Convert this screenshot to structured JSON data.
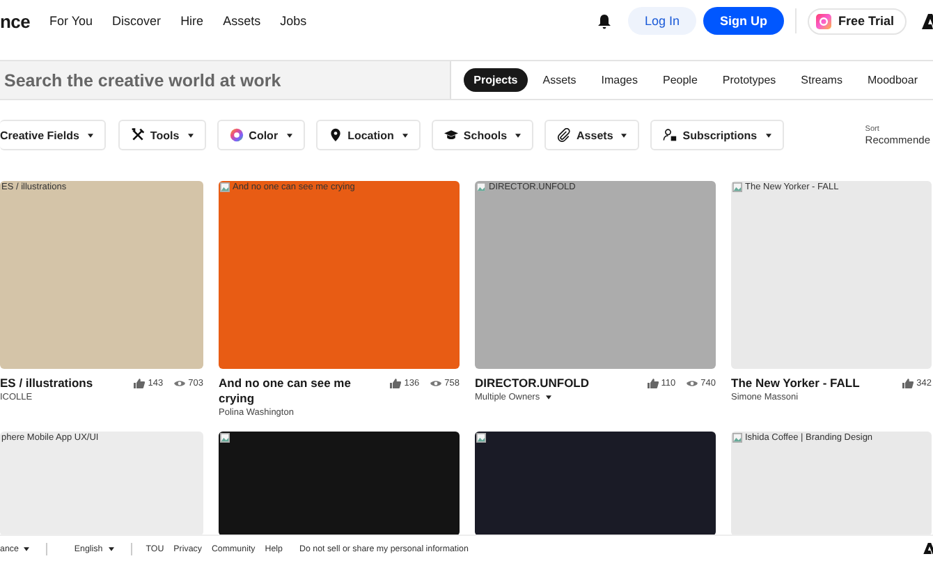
{
  "header": {
    "logo": "nce",
    "nav": [
      "For You",
      "Discover",
      "Hire",
      "Assets",
      "Jobs"
    ],
    "login": "Log In",
    "signup": "Sign Up",
    "trial": "Free Trial"
  },
  "search": {
    "placeholder": "Search the creative world at work"
  },
  "tabs": [
    {
      "label": "Projects",
      "selected": true
    },
    {
      "label": "Assets",
      "selected": false
    },
    {
      "label": "Images",
      "selected": false
    },
    {
      "label": "People",
      "selected": false
    },
    {
      "label": "Prototypes",
      "selected": false
    },
    {
      "label": "Streams",
      "selected": false
    },
    {
      "label": "Moodboar",
      "selected": false
    }
  ],
  "filters": [
    {
      "label": "Creative Fields",
      "kind": "none"
    },
    {
      "label": "Tools",
      "kind": "tools"
    },
    {
      "label": "Color",
      "kind": "color"
    },
    {
      "label": "Location",
      "kind": "pin"
    },
    {
      "label": "Schools",
      "kind": "cap"
    },
    {
      "label": "Assets",
      "kind": "clip"
    },
    {
      "label": "Subscriptions",
      "kind": "people"
    }
  ],
  "sort": {
    "label": "Sort",
    "value": "Recommende"
  },
  "projects": [
    {
      "alt": "ES / illustrations",
      "broken": false,
      "color": "#d4c4a8",
      "title": "ES / illustrations",
      "owner": "ICOLLE",
      "owner_menu": false,
      "likes": "143",
      "views": "703"
    },
    {
      "alt": "And no one can see me crying",
      "broken": true,
      "color": "#e85c14",
      "title": "And no one can see me crying",
      "owner": "Polina Washington",
      "owner_menu": false,
      "likes": "136",
      "views": "758"
    },
    {
      "alt": "DIRECTOR.UNFOLD",
      "broken": true,
      "color": "#acacac",
      "title": "DIRECTOR.UNFOLD",
      "owner": "Multiple Owners",
      "owner_menu": true,
      "likes": "110",
      "views": "740"
    },
    {
      "alt": "The New Yorker - FALL",
      "broken": true,
      "color": "#e9e9e9",
      "title": "The New Yorker - FALL",
      "owner": "Simone Massoni",
      "owner_menu": false,
      "likes": "342"
    },
    {
      "alt": "phere Mobile App UX/UI",
      "broken": false,
      "color": "#ececec"
    },
    {
      "broken": true,
      "color": "#141414"
    },
    {
      "broken": true,
      "color": "#1a1b26"
    },
    {
      "alt": "Ishida Coffee | Branding Design",
      "broken": true,
      "color": "#e9e9e9"
    }
  ],
  "footer": {
    "brand": "ance",
    "language": "English",
    "links": [
      "TOU",
      "Privacy",
      "Community",
      "Help",
      "Do not sell or share my personal information"
    ]
  }
}
